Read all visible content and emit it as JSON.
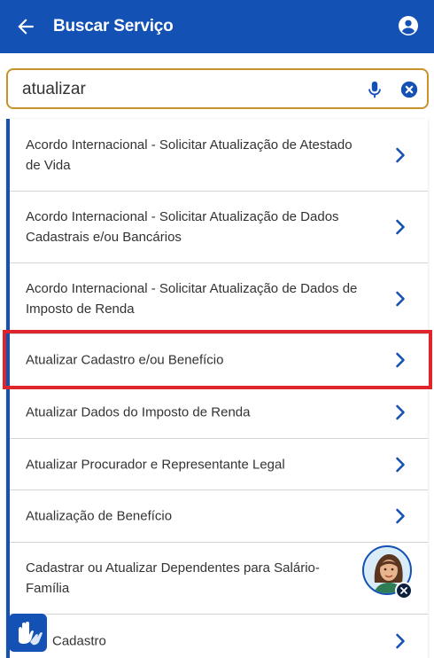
{
  "header": {
    "title": "Buscar Serviço",
    "back_icon": "arrow-left-icon",
    "account_icon": "account-circle-icon",
    "background": "#1351b4"
  },
  "search": {
    "value": "atualizar",
    "mic_icon": "microphone-icon",
    "clear_icon": "clear-circle-icon",
    "border_color": "#c8932a"
  },
  "results": [
    {
      "label": "Acordo Internacional - Solicitar Atualização de Atestado de Vida",
      "icon": "chevron-right-icon"
    },
    {
      "label": "Acordo Internacional - Solicitar Atualização de Dados Cadastrais e/ou Bancários",
      "icon": "chevron-right-icon"
    },
    {
      "label": "Acordo Internacional - Solicitar Atualização de Dados de Imposto de Renda",
      "icon": "chevron-right-icon"
    },
    {
      "label": "Atualizar Cadastro e/ou Benefício",
      "icon": "chevron-right-icon",
      "highlighted": true
    },
    {
      "label": "Atualizar Dados do Imposto de Renda",
      "icon": "chevron-right-icon"
    },
    {
      "label": "Atualizar Procurador e Representante Legal",
      "icon": "chevron-right-icon"
    },
    {
      "label": "Atualização de Benefício",
      "icon": "chevron-right-icon"
    },
    {
      "label": "Cadastrar ou Atualizar Dependentes para Salário-Família",
      "icon": "chevron-right-icon"
    },
    {
      "label": "Cadastro",
      "icon": "chevron-right-icon"
    }
  ],
  "highlight_color": "#e0242b",
  "assistant": {
    "icon": "virtual-assistant-avatar-icon",
    "close_icon": "close-icon"
  },
  "accessibility": {
    "icon": "sign-language-hands-icon"
  }
}
